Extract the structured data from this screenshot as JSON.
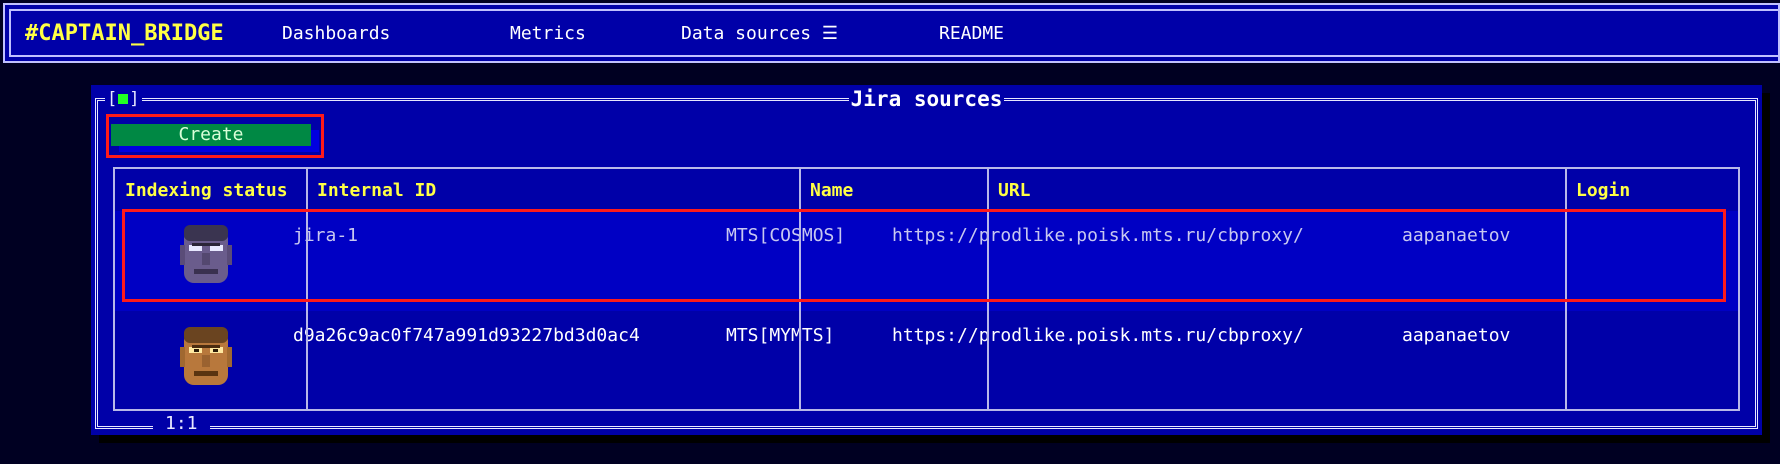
{
  "topbar": {
    "brand": "#CAPTAIN_BRIDGE",
    "nav": {
      "dashboards": "Dashboards",
      "metrics": "Metrics",
      "data_sources": "Data sources ☰",
      "readme": "README"
    }
  },
  "panel": {
    "title": "Jira sources",
    "control": "[■]",
    "footer": "1:1",
    "create_label": "Create"
  },
  "table": {
    "headers": [
      "Indexing status",
      "Internal ID",
      "Name",
      "URL",
      "Login"
    ],
    "rows": [
      {
        "status_icon": "doomguy-face-icon",
        "internal_id": "jira-1",
        "name": "MTS[COSMOS]",
        "url": "https://prodlike.poisk.mts.ru/cbproxy/",
        "login": "aapanaetov"
      },
      {
        "status_icon": "doomguy-face-icon",
        "internal_id": "d9a26c9ac0f747a991d93227bd3d0ac4",
        "name": "MTS[MYMTS]",
        "url": "https://prodlike.poisk.mts.ru/cbproxy/",
        "login": "aapanaetov"
      }
    ]
  },
  "colors": {
    "background": "#0000a8",
    "accent_yellow": "#ffff44",
    "button_green": "#008844",
    "highlight_red": "#ff1a1a"
  }
}
